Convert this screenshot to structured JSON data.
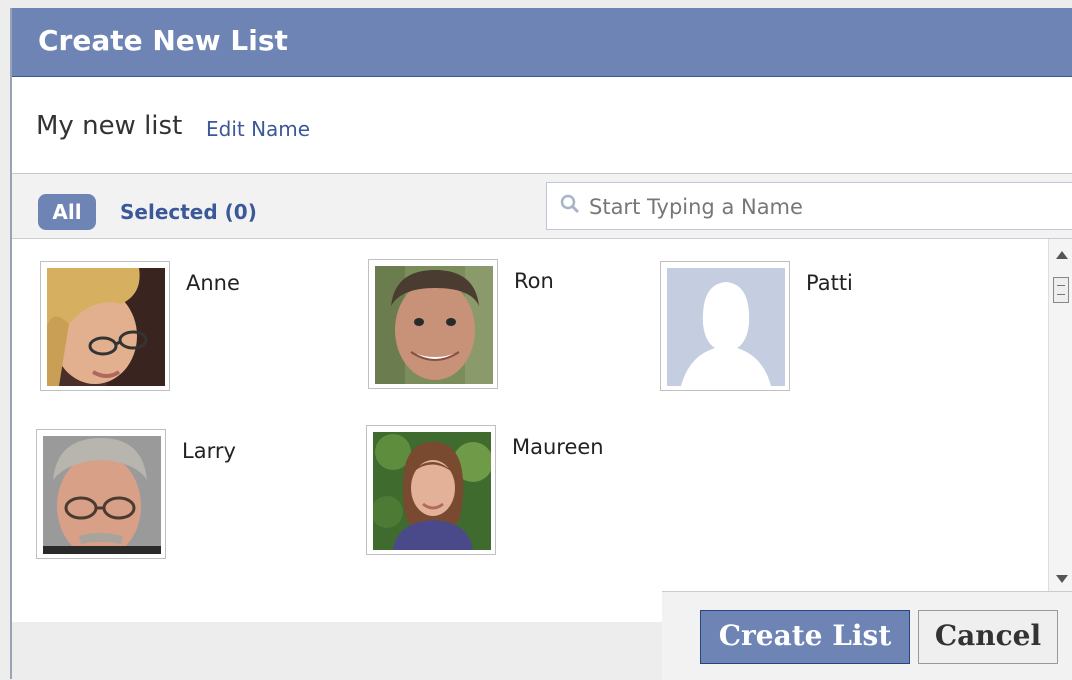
{
  "dialog": {
    "title": "Create New List",
    "list_name": "My new list",
    "edit_name_label": "Edit Name"
  },
  "filter": {
    "all_label": "All",
    "selected_label": "Selected (0)",
    "search_placeholder": "Start Typing a Name"
  },
  "friends": [
    {
      "name": "Anne"
    },
    {
      "name": "Ron"
    },
    {
      "name": "Patti"
    },
    {
      "name": "Larry"
    },
    {
      "name": "Maureen"
    }
  ],
  "footer": {
    "create_label": "Create List",
    "cancel_label": "Cancel"
  },
  "colors": {
    "header_blue": "#6d84b4",
    "link_blue": "#3b5998"
  }
}
